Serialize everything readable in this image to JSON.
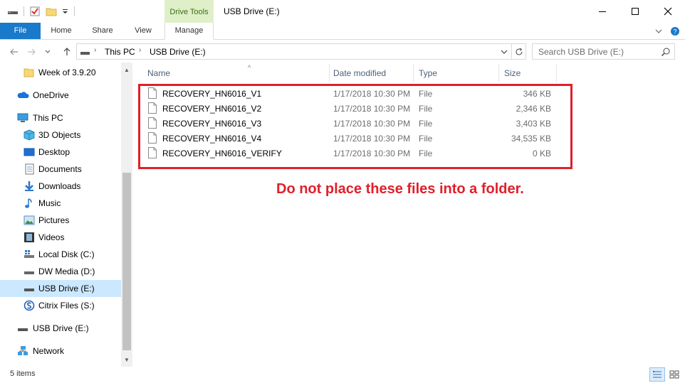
{
  "window": {
    "title": "USB Drive (E:)",
    "context_tab": "Drive Tools"
  },
  "ribbon": {
    "tabs": [
      "File",
      "Home",
      "Share",
      "View",
      "Manage"
    ],
    "accent": "#1979ca",
    "context_color": "#dff0c8"
  },
  "address": {
    "crumbs": [
      "This PC",
      "USB Drive (E:)"
    ],
    "search_placeholder": "Search USB Drive (E:)"
  },
  "sidebar": {
    "items": [
      {
        "label": "Week of 3.9.20",
        "icon": "folder-icon"
      },
      {
        "label": "OneDrive",
        "icon": "cloud-icon"
      },
      {
        "label": "This PC",
        "icon": "computer-icon"
      },
      {
        "label": "3D Objects",
        "icon": "cube-icon"
      },
      {
        "label": "Desktop",
        "icon": "desktop-icon"
      },
      {
        "label": "Documents",
        "icon": "documents-icon"
      },
      {
        "label": "Downloads",
        "icon": "download-icon"
      },
      {
        "label": "Music",
        "icon": "music-icon"
      },
      {
        "label": "Pictures",
        "icon": "pictures-icon"
      },
      {
        "label": "Videos",
        "icon": "videos-icon"
      },
      {
        "label": "Local Disk (C:)",
        "icon": "disk-icon"
      },
      {
        "label": "DW Media (D:)",
        "icon": "drive-icon"
      },
      {
        "label": "USB Drive (E:)",
        "icon": "usb-drive-icon",
        "selected": true
      },
      {
        "label": "Citrix Files (S:)",
        "icon": "citrix-icon"
      },
      {
        "label": "USB Drive (E:)",
        "icon": "usb-drive-icon"
      },
      {
        "label": "Network",
        "icon": "network-icon"
      }
    ]
  },
  "columns": {
    "name": "Name",
    "date": "Date modified",
    "type": "Type",
    "size": "Size"
  },
  "files": [
    {
      "name": "RECOVERY_HN6016_V1",
      "date": "1/17/2018 10:30 PM",
      "type": "File",
      "size": "346 KB"
    },
    {
      "name": "RECOVERY_HN6016_V2",
      "date": "1/17/2018 10:30 PM",
      "type": "File",
      "size": "2,346 KB"
    },
    {
      "name": "RECOVERY_HN6016_V3",
      "date": "1/17/2018 10:30 PM",
      "type": "File",
      "size": "3,403 KB"
    },
    {
      "name": "RECOVERY_HN6016_V4",
      "date": "1/17/2018 10:30 PM",
      "type": "File",
      "size": "34,535 KB"
    },
    {
      "name": "RECOVERY_HN6016_VERIFY",
      "date": "1/17/2018 10:30 PM",
      "type": "File",
      "size": "0 KB"
    }
  ],
  "annotation": {
    "text": "Do not place these files into a folder.",
    "color": "#e0202a"
  },
  "status": {
    "item_count": "5 items"
  }
}
